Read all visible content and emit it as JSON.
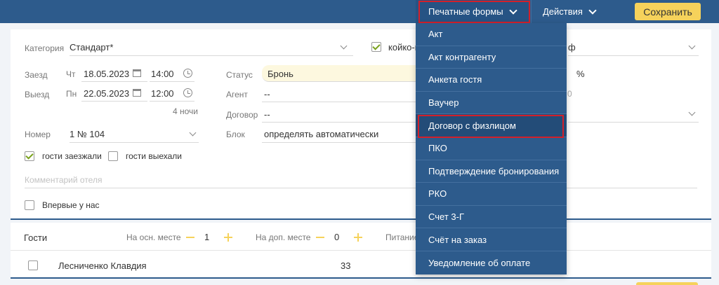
{
  "topbar": {
    "print_forms": "Печатные формы",
    "actions": "Действия",
    "save": "Сохранить"
  },
  "booking": {
    "category_label": "Категория",
    "category_value": "Стандарт*",
    "bunk_label": "койко-м",
    "tariff_fragment": "ф",
    "checkin_label": "Заезд",
    "checkin_day": "Чт",
    "checkin_date": "18.05.2023",
    "checkin_time": "14:00",
    "checkout_label": "Выезд",
    "checkout_day": "Пн",
    "checkout_date": "22.05.2023",
    "checkout_time": "12:00",
    "nights": "4 ночи",
    "status_label": "Статус",
    "status_value": "Бронь",
    "percent": "%",
    "agent_label": "Агент",
    "agent_value": "--",
    "agent_right_fragment": "0",
    "contract_label": "Договор",
    "contract_value": "--",
    "room_label": "Номер",
    "room_value": "1 № 104",
    "block_label": "Блок",
    "block_value": "определять автоматически",
    "guests_checked_in": "гости заезжали",
    "guests_checked_out": "гости выехали",
    "hotel_comment_placeholder": "Комментарий отеля",
    "first_time": "Впервые у нас"
  },
  "guests": {
    "title": "Гости",
    "main_place_label": "На осн. месте",
    "main_place_count": "1",
    "extra_place_label": "На доп. месте",
    "extra_place_count": "0",
    "meals_label": "Питание",
    "rows": [
      {
        "name": "Лесниченко Клавдия",
        "age": "33"
      }
    ]
  },
  "print_menu": {
    "items": [
      "Акт",
      "Акт контрагенту",
      "Анкета гостя",
      "Ваучер",
      "Договор с физлицом",
      "ПКО",
      "Подтверждение бронирования",
      "РКО",
      "Счет 3-Г",
      "Счёт на заказ",
      "Уведомление об оплате"
    ]
  }
}
